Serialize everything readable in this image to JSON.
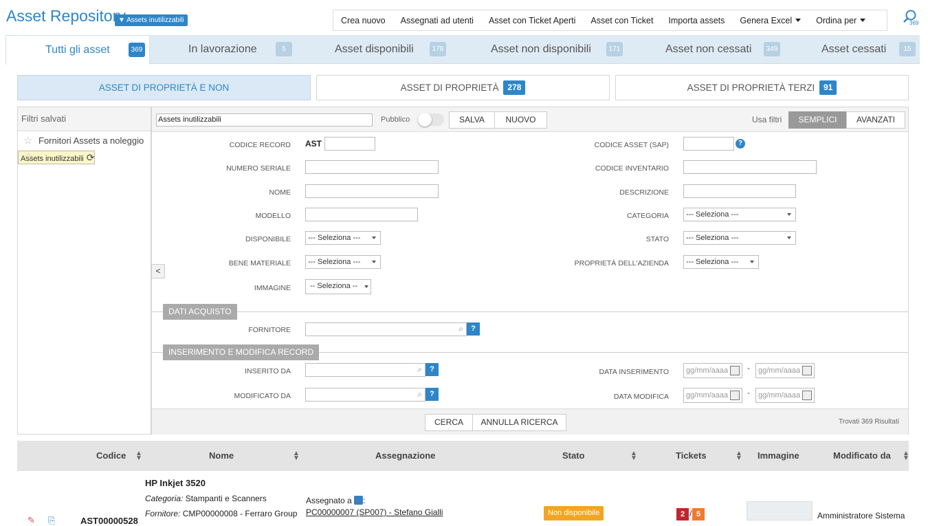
{
  "header": {
    "title": "Asset Repository",
    "filter_badge": "Assets inutilizzabili",
    "search_count": "369"
  },
  "topmenu": [
    "Crea nuovo",
    "Assegnati ad utenti",
    "Asset con Ticket Aperti",
    "Asset con Ticket",
    "Importa assets",
    "Genera Excel",
    "Ordina per"
  ],
  "tabs": [
    {
      "label": "Tutti gli asset",
      "count": "369"
    },
    {
      "label": "In lavorazione",
      "count": "5"
    },
    {
      "label": "Asset disponibili",
      "count": "178"
    },
    {
      "label": "Asset non disponibili",
      "count": "171"
    },
    {
      "label": "Asset non cessati",
      "count": "349"
    },
    {
      "label": "Asset cessati",
      "count": "15"
    }
  ],
  "ownership": [
    {
      "label": "ASSET DI PROPRIETÀ E NON",
      "count": ""
    },
    {
      "label": "ASSET DI PROPRIETÀ",
      "count": "278"
    },
    {
      "label": "ASSET DI PROPRIETÀ TERZI",
      "count": "91"
    }
  ],
  "saved_filters": {
    "title": "Filtri salvati",
    "items": [
      "Fornitori Assets a noleggio",
      "Assets inutilizzabili"
    ]
  },
  "filter_head": {
    "name": "Assets inutilizzabili",
    "public": "Pubblico",
    "save": "SALVA",
    "new": "NUOVO",
    "use_filters": "Usa filtri",
    "simple": "SEMPLICI",
    "advanced": "AVANZATI"
  },
  "fields": {
    "codice_record": "CODICE RECORD",
    "ast_prefix": "AST",
    "codice_asset": "CODICE ASSET (SAP)",
    "numero_seriale": "NUMERO SERIALE",
    "codice_inventario": "CODICE INVENTARIO",
    "nome": "NOME",
    "descrizione": "DESCRIZIONE",
    "modello": "MODELLO",
    "categoria": "CATEGORIA",
    "disponibile": "DISPONIBILE",
    "stato": "STATO",
    "bene_materiale": "BENE MATERIALE",
    "proprieta_azienda": "PROPRIETÀ DELL'AZIENDA",
    "immagine": "IMMAGINE",
    "select_placeholder": "--- Seleziona ---",
    "select_short": "-- Seleziona --",
    "fornitore": "FORNITORE",
    "inserito_da": "INSERITO DA",
    "modificato_da": "MODIFICATO DA",
    "data_inserimento": "DATA INSERIMENTO",
    "data_modifica": "DATA MODIFICA",
    "date_placeholder": "gg/mm/aaaa"
  },
  "sections": {
    "dati_acquisto": "DATI ACQUISTO",
    "inserimento": "INSERIMENTO E MODIFICA RECORD"
  },
  "footer": {
    "cerca": "CERCA",
    "annulla": "ANNULLA RICERCA",
    "found": "Trovati 369 Risultati"
  },
  "table": {
    "headers": [
      "Codice",
      "Nome",
      "Assegnazione",
      "Stato",
      "Tickets",
      "Immagine",
      "Modificato da"
    ],
    "row": {
      "code": "AST00000528",
      "name": "HP Inkjet 3520",
      "categoria_label": "Categoria:",
      "categoria": "Stampanti e Scanners",
      "fornitore_label": "Fornitore:",
      "fornitore": "CMP00000008 - Ferraro Group",
      "assegnato": "Assegnato a",
      "assegnato_link": "PC00000007 (SP007) - Stefano Gialli",
      "stato": "Non disponibile",
      "tickets_open": "2",
      "tickets_total": "5",
      "modificato": "Amministratore Sistema"
    }
  }
}
